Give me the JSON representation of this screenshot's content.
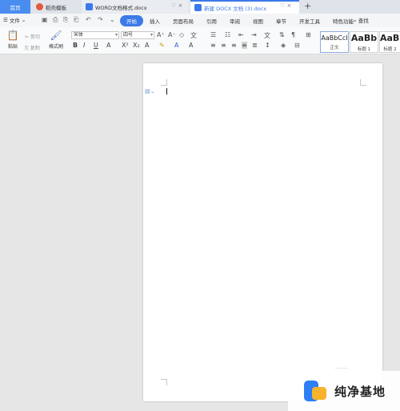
{
  "tabs": [
    {
      "label": "首页"
    },
    {
      "label": "稻壳模板"
    },
    {
      "label": "WORD文档格式.docx"
    },
    {
      "label": "新建 DOCX 文档 (3).docx"
    }
  ],
  "new_tab_glyph": "+",
  "menu": {
    "file_label": "文件",
    "tabs": [
      "开始",
      "插入",
      "页面布局",
      "引用",
      "审阅",
      "视图",
      "章节",
      "开发工具",
      "特色功能"
    ],
    "active_tab": "开始",
    "search_label": "查找"
  },
  "ribbon": {
    "paste_label": "粘贴",
    "cut_label": "剪切",
    "copy_label": "复制",
    "format_painter_label": "格式刷",
    "font_name": "宋体",
    "font_size": "四号",
    "styles": [
      {
        "sample": "AaBbCcI",
        "name": "正文"
      },
      {
        "sample": "AaBb",
        "name": "标题 1"
      },
      {
        "sample": "AaBb",
        "name": "标题 2"
      }
    ]
  },
  "watermark": {
    "text": "纯净基地"
  },
  "colors": {
    "accent": "#3b7ae8",
    "home_tab": "#4a8df0",
    "page_bg": "#ffffff",
    "canvas_bg": "#e6e6e6",
    "logo_blue": "#2d7ff5",
    "logo_yellow": "#f7b32b"
  }
}
